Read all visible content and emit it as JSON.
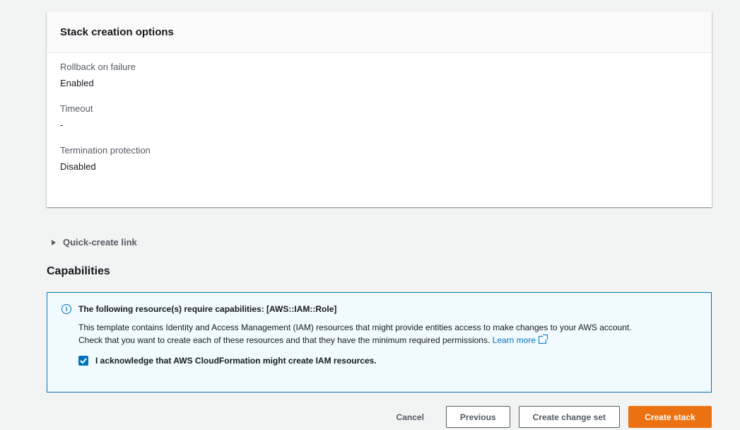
{
  "stack_options": {
    "title": "Stack creation options",
    "rollback_label": "Rollback on failure",
    "rollback_value": "Enabled",
    "timeout_label": "Timeout",
    "timeout_value": "-",
    "termination_label": "Termination protection",
    "termination_value": "Disabled"
  },
  "quick_create": {
    "label": "Quick-create link"
  },
  "capabilities": {
    "title": "Capabilities",
    "alert_title": "The following resource(s) require capabilities: [AWS::IAM::Role]",
    "alert_text_line1": "This template contains Identity and Access Management (IAM) resources that might provide entities access to make changes to your AWS account.",
    "alert_text_line2": "Check that you want to create each of these resources and that they have the minimum required permissions.",
    "learn_more": "Learn more",
    "ack_label": "I acknowledge that AWS CloudFormation might create IAM resources.",
    "ack_checked": true
  },
  "actions": {
    "cancel": "Cancel",
    "previous": "Previous",
    "create_change_set": "Create change set",
    "create_stack": "Create stack"
  },
  "colors": {
    "accent": "#0073bb",
    "primary_button": "#ec7211",
    "background": "#f2f3f3"
  },
  "icons": {
    "expander": "caret-right-icon",
    "info": "info-icon",
    "external": "external-link-icon",
    "checkbox": "checkmark-icon"
  }
}
